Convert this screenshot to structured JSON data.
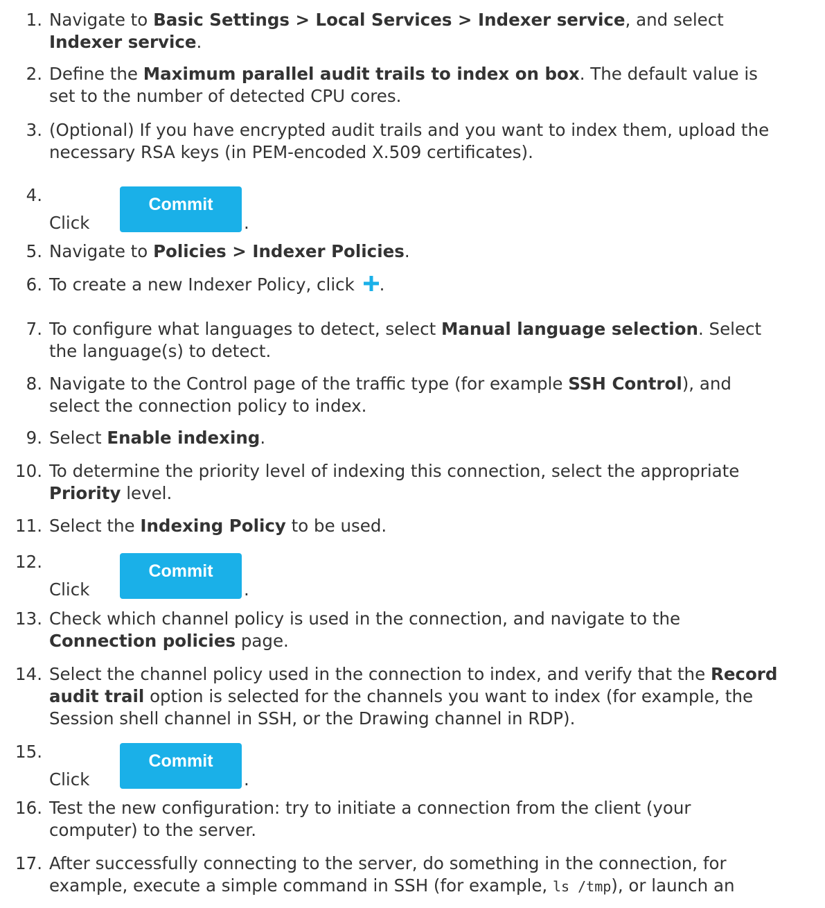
{
  "steps": [
    {
      "num": "1.",
      "lines": [
        [
          "Navigate to ",
          {
            "b": "Basic Settings > Local Services > Indexer service"
          },
          ", and select"
        ],
        [
          {
            "b": "Indexer service"
          },
          "."
        ]
      ]
    },
    {
      "num": "2.",
      "lines": [
        [
          "Define the ",
          {
            "b": "Maximum parallel audit trails to index on box"
          },
          ". The default value is"
        ],
        [
          "set to the number of detected CPU cores."
        ]
      ]
    },
    {
      "num": "3.",
      "lines": [
        [
          "(Optional) If you have encrypted audit trails and you want to index them, upload the"
        ],
        [
          "necessary RSA keys (in PEM-encoded X.509 certificates)."
        ]
      ]
    },
    {
      "num": "4.",
      "click": "Click",
      "button": "Commit",
      "after": "."
    },
    {
      "num": "5.",
      "lines": [
        [
          "Navigate to ",
          {
            "b": "Policies > Indexer Policies"
          },
          "."
        ]
      ]
    },
    {
      "num": "6.",
      "lines": [
        [
          "To create a new Indexer Policy, click ",
          {
            "icon": "plus-icon"
          },
          "."
        ]
      ]
    },
    {
      "num": "7.",
      "lines": [
        [
          "To configure what languages to detect, select ",
          {
            "b": "Manual language selection"
          },
          ". Select"
        ],
        [
          "the language(s) to detect."
        ]
      ]
    },
    {
      "num": "8.",
      "lines": [
        [
          "Navigate to the Control page of the traffic type (for example ",
          {
            "b": "SSH Control"
          },
          "), and"
        ],
        [
          "select the connection policy to index."
        ]
      ]
    },
    {
      "num": "9.",
      "lines": [
        [
          "Select ",
          {
            "b": "Enable indexing"
          },
          "."
        ]
      ]
    },
    {
      "num": "10.",
      "lines": [
        [
          "To determine the priority level of indexing this connection, select the appropriate"
        ],
        [
          {
            "b": "Priority"
          },
          " level."
        ]
      ]
    },
    {
      "num": "11.",
      "lines": [
        [
          "Select the ",
          {
            "b": "Indexing Policy"
          },
          " to be used."
        ]
      ]
    },
    {
      "num": "12.",
      "click": "Click",
      "button": "Commit",
      "after": "."
    },
    {
      "num": "13.",
      "lines": [
        [
          "Check which channel policy is used in the connection, and navigate to the"
        ],
        [
          {
            "b": "Connection policies"
          },
          " page."
        ]
      ]
    },
    {
      "num": "14.",
      "lines": [
        [
          "Select the channel policy used in the connection to index, and verify that the ",
          {
            "b": "Record"
          }
        ],
        [
          {
            "b": "audit trail"
          },
          " option is selected for the channels you want to index (for example, the"
        ],
        [
          "Session shell channel in SSH, or the Drawing channel in RDP)."
        ]
      ]
    },
    {
      "num": "15.",
      "click": "Click",
      "button": "Commit",
      "after": "."
    },
    {
      "num": "16.",
      "lines": [
        [
          "Test the new configuration: try to initiate a connection from the client (your"
        ],
        [
          "computer) to the server."
        ]
      ]
    },
    {
      "num": "17.",
      "lines": [
        [
          "After successfully connecting to the server, do something in the connection, for"
        ],
        [
          "example, execute a simple command in SSH (for example, ",
          {
            "code": "ls /tmp"
          },
          "), or launch an"
        ]
      ]
    }
  ],
  "colors": {
    "text": "#333333",
    "button": "#1ab0e8",
    "button_text": "#ffffff",
    "icon": "#1ab0e8"
  }
}
